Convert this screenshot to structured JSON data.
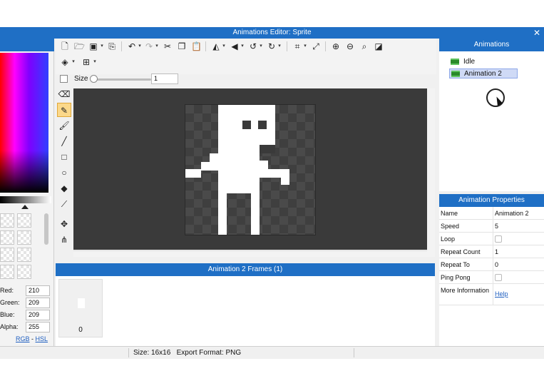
{
  "window": {
    "title": "Animations Editor: Sprite",
    "close_glyph": "✕"
  },
  "colors": {
    "accent": "#1f6fc5",
    "canvas_bg": "#3a3a3a",
    "sprite": "#ffffff",
    "active_tool": "#fbd88a"
  },
  "color_panel": {
    "rgb": [
      {
        "label": "Red:",
        "value": "210"
      },
      {
        "label": "Green:",
        "value": "209"
      },
      {
        "label": "Blue:",
        "value": "209"
      },
      {
        "label": "Alpha:",
        "value": "255"
      }
    ],
    "mode_rgb": "RGB",
    "mode_sep": " - ",
    "mode_hsl": "HSL"
  },
  "toolbar": {
    "icons": [
      "new-file-icon",
      "open-folder-icon",
      "save-icon",
      "export-icon",
      "undo-icon",
      "redo-icon",
      "cut-icon",
      "copy-icon",
      "paste-icon",
      "flip-horizontal-icon",
      "flip-vertical-icon",
      "rotate-left-icon",
      "rotate-right-icon",
      "crop-icon",
      "resize-icon",
      "zoom-in-icon",
      "zoom-out-icon",
      "zoom-fit-icon",
      "invert-icon",
      "layers-icon",
      "grid-icon"
    ],
    "size_label": "Size",
    "size_value": "1"
  },
  "tools": {
    "items": [
      "eraser-tool",
      "pencil-tool",
      "brush-tool",
      "line-tool",
      "rectangle-tool",
      "ellipse-tool",
      "fill-tool",
      "eyedropper-tool",
      "move-tool",
      "transform-tool"
    ],
    "active": "pencil-tool"
  },
  "frames": {
    "header": "Animation 2 Frames (1)",
    "items": [
      {
        "number": "0"
      }
    ]
  },
  "animations": {
    "header": "Animations",
    "items": [
      {
        "label": "Idle",
        "selected": false
      },
      {
        "label": "Animation 2",
        "selected": true
      }
    ]
  },
  "properties": {
    "header": "Animation Properties",
    "rows": [
      {
        "name": "Name",
        "value": "Animation 2"
      },
      {
        "name": "Speed",
        "value": "5"
      },
      {
        "name": "Loop",
        "checkbox": false
      },
      {
        "name": "Repeat Count",
        "value": "1"
      },
      {
        "name": "Repeat To",
        "value": "0"
      },
      {
        "name": "Ping Pong",
        "checkbox": false
      },
      {
        "name": "More Information",
        "link": "Help"
      }
    ]
  },
  "status": {
    "text": "Size: 16x16   Export Format: PNG"
  }
}
